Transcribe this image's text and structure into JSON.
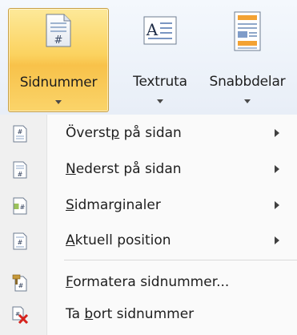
{
  "ribbon": {
    "buttons": [
      {
        "label": "Sidnummer",
        "icon": "page-number-icon",
        "active": true
      },
      {
        "label": "Textruta",
        "icon": "text-box-icon",
        "active": false
      },
      {
        "label": "Snabbdelar",
        "icon": "quick-parts-icon",
        "active": false
      }
    ]
  },
  "menu": {
    "items": [
      {
        "pre": "Överst",
        "key": "p",
        "post": " på sidan",
        "icon": "page-top-icon",
        "submenu": true
      },
      {
        "pre": "",
        "key": "N",
        "post": "ederst på sidan",
        "icon": "page-bottom-icon",
        "submenu": true
      },
      {
        "pre": "",
        "key": "S",
        "post": "idmarginaler",
        "icon": "page-margins-icon",
        "submenu": true
      },
      {
        "pre": "",
        "key": "A",
        "post": "ktuell position",
        "icon": "current-position-icon",
        "submenu": true
      },
      {
        "pre": "",
        "key": "F",
        "post": "ormatera sidnummer...",
        "icon": "format-page-number-icon",
        "submenu": false
      },
      {
        "pre": "Ta ",
        "key": "b",
        "post": "ort sidnummer",
        "icon": "remove-page-number-icon",
        "submenu": false
      }
    ]
  },
  "colors": {
    "active_button": "#fbd25f",
    "ribbon_bg": "#e8eef7",
    "menu_bg": "#fafafa",
    "delete_red": "#d6221c"
  }
}
